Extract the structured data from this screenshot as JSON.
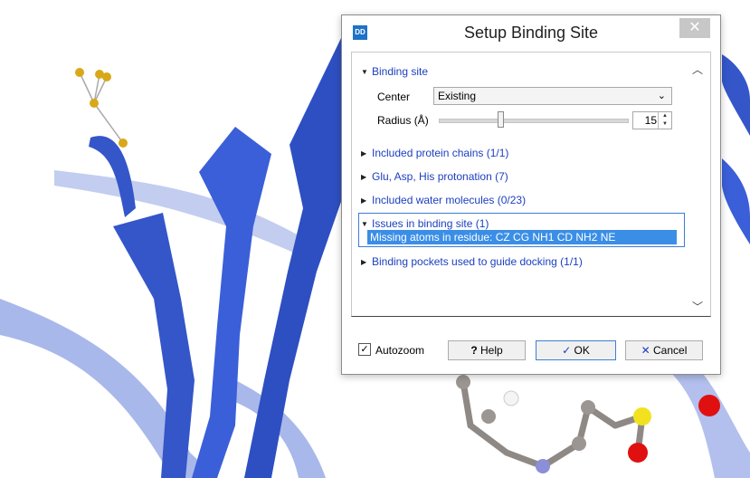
{
  "dialog": {
    "title": "Setup Binding Site",
    "app_icon_text": "DD",
    "close_glyph": "✕"
  },
  "binding_site": {
    "header": "Binding site",
    "center_label": "Center",
    "center_value": "Existing",
    "radius_label": "Radius (Å)",
    "radius_value": "15"
  },
  "sections": {
    "chains": "Included protein chains (1/1)",
    "protonation": "Glu, Asp, His protonation (7)",
    "water": "Included water molecules (0/23)",
    "issues": "Issues in binding site (1)",
    "issue_item": "Missing atoms in residue: CZ CG NH1 CD NH2 NE",
    "pockets": "Binding pockets used to guide docking (1/1)"
  },
  "footer": {
    "autozoom_label": "Autozoom",
    "autozoom_checked": true,
    "help_label": "Help",
    "ok_label": "OK",
    "cancel_label": "Cancel"
  },
  "icons": {
    "expanded": "chevron-down-icon",
    "collapsed": "chevron-right-icon",
    "help": "question-icon",
    "ok": "checkmark-icon",
    "cancel": "x-icon"
  },
  "colors": {
    "link_blue": "#1b3fbf",
    "selection_blue": "#3a8ee6",
    "ribbon_blue": "#3456c9"
  }
}
